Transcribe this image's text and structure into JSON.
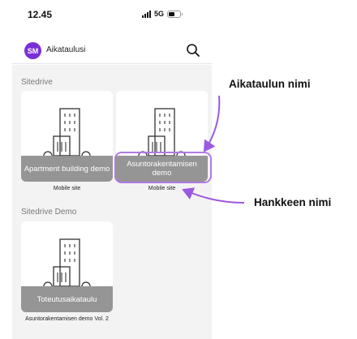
{
  "status_bar": {
    "time": "12.45",
    "network": "5G"
  },
  "header": {
    "avatar_initials": "SM",
    "title": "Aikataulusi"
  },
  "sections": [
    {
      "title": "Sitedrive",
      "items": [
        {
          "tile_label": "Apartment building demo",
          "caption": "Mobile site"
        },
        {
          "tile_label": "Asuntorakentamisen demo",
          "caption": "Mobile site"
        }
      ]
    },
    {
      "title": "Sitedrive Demo",
      "items": [
        {
          "tile_label": "Toteutusaikataulu",
          "caption": "Asuntorakentamisen demo Vol. 2"
        }
      ]
    }
  ],
  "annotations": {
    "schedule_name": "Aikataulun nimi",
    "project_name": "Hankkeen nimi"
  },
  "colors": {
    "accent": "#7a2fd6",
    "annotation_arrow": "#9b59e0",
    "highlight": "#b07ae6",
    "tile_overlay": "#8a8a8a",
    "background": "#f3f3f4"
  },
  "icons": [
    "search-icon",
    "building-icon",
    "signal-icon",
    "battery-icon"
  ]
}
